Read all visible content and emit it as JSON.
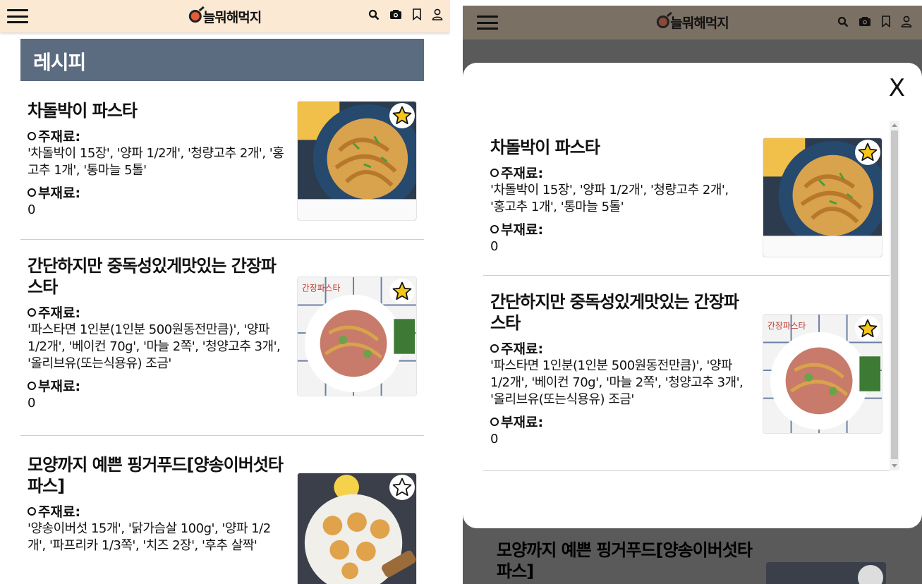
{
  "header": {
    "logo_text": "늘뭐해먹지",
    "icons": [
      "search-icon",
      "camera-icon",
      "bookmark-icon",
      "user-icon"
    ]
  },
  "section_title": "레시피",
  "labels": {
    "main": "주재료:",
    "sub": "부재료:"
  },
  "recipes": [
    {
      "title": "차돌박이 파스타",
      "main_ingredients": "'차돌박이 15장', '양파 1/2개', '청량고추 2개', '홍고추 1개', '통마늘 5톨'",
      "sub_ingredients": "0",
      "favorited": true
    },
    {
      "title": "간단하지만 중독성있게맛있는 간장파스타",
      "main_ingredients": "'파스타면 1인분(1인분 500원동전만큼)', '양파 1/2개', '베이컨 70g', '마늘 2쪽', '청양고추 3개', '올리브유(또는식용유) 조금'",
      "sub_ingredients": "0",
      "favorited": true
    },
    {
      "title": "모양까지 예쁜 핑거푸드[양송이버섯타파스]",
      "main_ingredients": "'양송이버섯 15개', '닭가슴살 100g', '양파 1/2개', '파프리카 1/3쪽', '치즈 2장', '후추 살짝'",
      "sub_ingredients": "",
      "favorited": false
    }
  ],
  "modal": {
    "close_label": "X"
  },
  "colors": {
    "header_bg": "#fbe9d3",
    "section_bg": "#5b6b80",
    "star_fill": "#f5c518"
  }
}
